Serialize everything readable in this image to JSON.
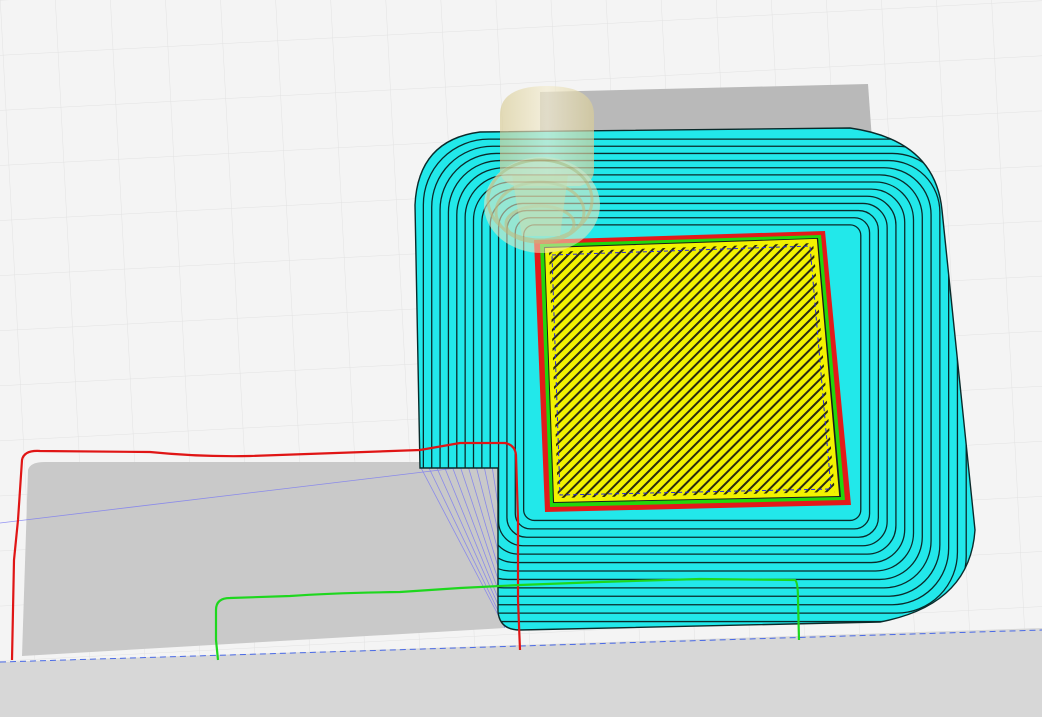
{
  "app": {
    "view": "sliced-layer-preview",
    "tool": "gcode-preview"
  },
  "scene": {
    "colors": {
      "bed_background": "#f4f4f4",
      "grid_line": "#e0e0e0",
      "floor": "#d6d6d6",
      "object_shadow": "#bdbdbd",
      "skirt_brim": "#22e8ea",
      "infill": "#f2f200",
      "outer_perimeter": "#e31a1a",
      "inner_perimeter": "#23d70a",
      "travel_move": "#3a3ae8",
      "extrusion_line": "#0b0b0b",
      "nozzle": "#e8dcaa",
      "annotation_red": "#e01515",
      "annotation_green": "#1ed71e"
    },
    "icons": [
      "nozzle-icon"
    ]
  }
}
